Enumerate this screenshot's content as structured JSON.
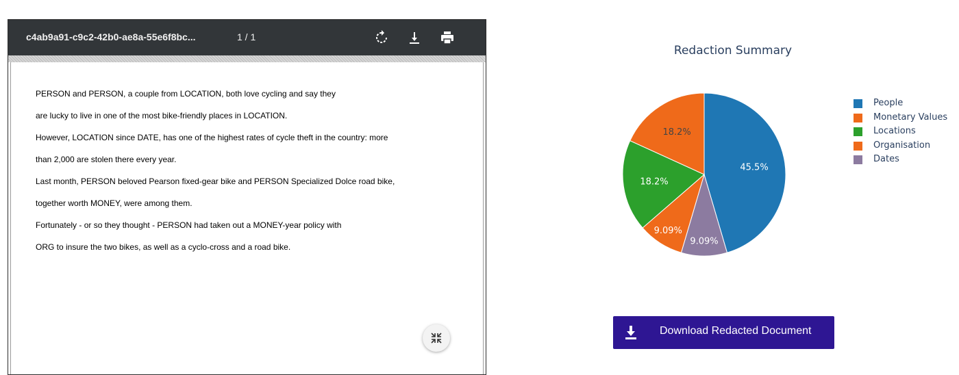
{
  "viewer": {
    "doc_title": "c4ab9a91-c9c2-42b0-ae8a-55e6f8bc...",
    "page_count": "1 / 1",
    "icons": [
      "rotate-icon",
      "download-icon",
      "print-icon",
      "fit-page-icon"
    ],
    "lines": [
      "PERSON and PERSON, a couple from LOCATION, both love cycling and say they",
      "are lucky to live in one of the most bike-friendly places in LOCATION.",
      "However, LOCATION since DATE, has one of the highest rates of cycle theft in the country: more",
      "than 2,000 are stolen there every year.",
      "Last month, PERSON beloved Pearson fixed-gear bike and PERSON Specialized Dolce road bike,",
      "together worth MONEY, were among them.",
      "Fortunately - or so they thought - PERSON had taken out a MONEY-year policy with",
      "ORG to insure the two bikes, as well as a cyclo-cross and a road bike."
    ]
  },
  "chart_data": {
    "type": "pie",
    "title": "Redaction Summary",
    "categories": [
      "People",
      "Monetary Values",
      "Locations",
      "Organisation",
      "Dates"
    ],
    "values": [
      45.5,
      0,
      18.2,
      18.2,
      9.09,
      9.09
    ],
    "slices": [
      {
        "name": "People",
        "value": 45.5,
        "label": "45.5%",
        "color": "#1f77b4"
      },
      {
        "name": "Dates",
        "value": 9.09,
        "label": "9.09%",
        "color": "#8c7ba0"
      },
      {
        "name": "Organisation",
        "value": 9.09,
        "label": "9.09%",
        "color": "#ef6a1a"
      },
      {
        "name": "Locations",
        "value": 18.2,
        "label": "18.2%",
        "color": "#2ca02c"
      },
      {
        "name": "Monetary Values",
        "value": 18.2,
        "label": "18.2%",
        "color": "#ef6a1a"
      }
    ],
    "legend": [
      {
        "name": "People",
        "color": "#1f77b4"
      },
      {
        "name": "Monetary Values",
        "color": "#ef6a1a"
      },
      {
        "name": "Locations",
        "color": "#2ca02c"
      },
      {
        "name": "Organisation",
        "color": "#ef6a1a"
      },
      {
        "name": "Dates",
        "color": "#8c7ba0"
      }
    ],
    "legend_placement": "right"
  },
  "download": {
    "label": "Download Redacted Document",
    "color": "#2e1693",
    "icon": "download-icon"
  }
}
